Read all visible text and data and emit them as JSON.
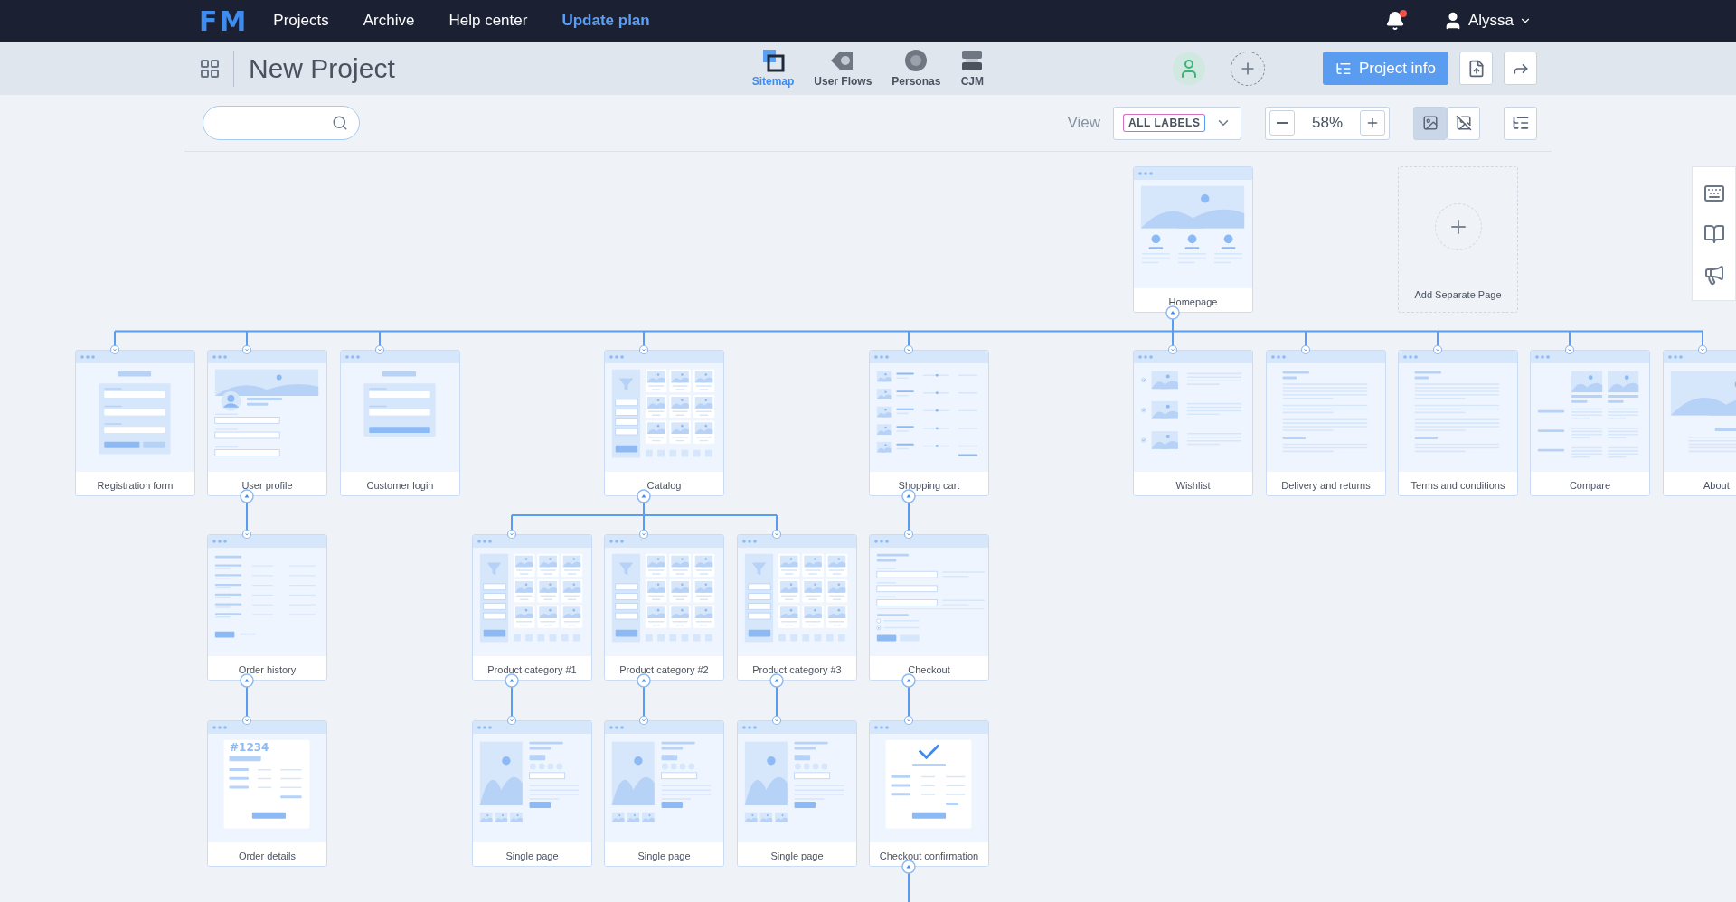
{
  "app": {
    "logo": "FM",
    "nav": [
      {
        "label": "Projects",
        "highlighted": false
      },
      {
        "label": "Archive",
        "highlighted": false
      },
      {
        "label": "Help center",
        "highlighted": false
      },
      {
        "label": "Update plan",
        "highlighted": true
      }
    ],
    "notifications": {
      "unread": true
    },
    "user": {
      "name": "Alyssa"
    }
  },
  "project": {
    "title": "New Project",
    "tabs": [
      {
        "label": "Sitemap",
        "kind": "sitemap",
        "selected": true
      },
      {
        "label": "User Flows",
        "kind": "flows",
        "selected": false
      },
      {
        "label": "Personas",
        "kind": "personas",
        "selected": false
      },
      {
        "label": "CJM",
        "kind": "cjm",
        "selected": false
      }
    ],
    "project_info_button": "Project info"
  },
  "toolbar": {
    "view_label": "View",
    "view_select": "ALL LABELS",
    "zoom": "58%",
    "image_toggles": [
      {
        "kind": "show",
        "selected": true
      },
      {
        "kind": "hide",
        "selected": false
      }
    ]
  },
  "sitemap": {
    "add_page": "Add Separate Page",
    "root": {
      "name": "Homepage",
      "kind": "home",
      "children": [
        {
          "name": "Registration form",
          "kind": "form"
        },
        {
          "name": "User profile",
          "kind": "profile",
          "children": [
            {
              "name": "Order history",
              "kind": "history",
              "children": [
                {
                  "name": "Order details",
                  "kind": "order",
                  "number": "#1234"
                }
              ]
            }
          ]
        },
        {
          "name": "Customer login",
          "kind": "login"
        },
        {
          "name": "Catalog",
          "kind": "catalog",
          "children": [
            {
              "name": "Product category #1",
              "kind": "catalog",
              "children": [
                {
                  "name": "Single page",
                  "kind": "single"
                }
              ]
            },
            {
              "name": "Product category #2",
              "kind": "catalog",
              "children": [
                {
                  "name": "Single page",
                  "kind": "single"
                }
              ]
            },
            {
              "name": "Product category #3",
              "kind": "catalog",
              "children": [
                {
                  "name": "Single page",
                  "kind": "single"
                }
              ]
            }
          ]
        },
        {
          "name": "Shopping cart",
          "kind": "cart",
          "children": [
            {
              "name": "Checkout",
              "kind": "checkout",
              "children": [
                {
                  "name": "Checkout confirmation",
                  "kind": "confirm",
                  "continues": true
                }
              ]
            }
          ]
        },
        {
          "name": "Wishlist",
          "kind": "wishlist"
        },
        {
          "name": "Delivery and returns",
          "kind": "text"
        },
        {
          "name": "Terms and conditions",
          "kind": "text"
        },
        {
          "name": "Compare",
          "kind": "compare"
        },
        {
          "name": "About",
          "kind": "about",
          "cut": true
        }
      ]
    }
  }
}
